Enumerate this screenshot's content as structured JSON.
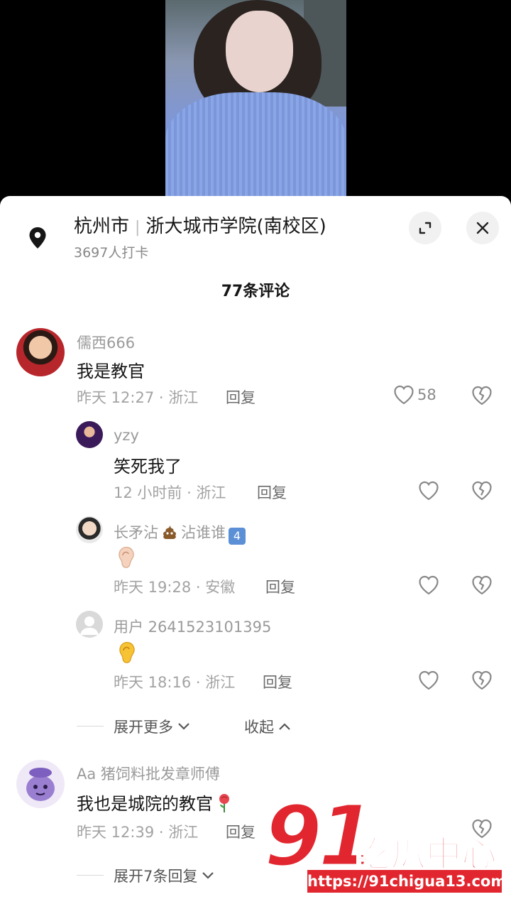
{
  "location": {
    "city": "杭州市",
    "place": "浙大城市学院(南校区)",
    "checkins": "3697人打卡"
  },
  "comments_header": "77条评论",
  "comments": [
    {
      "user": "儒西666",
      "text": "我是教官",
      "meta": "昨天 12:27 · 浙江",
      "reply": "回复",
      "likes": "58"
    },
    {
      "user": "yzy",
      "text": "笑死我了",
      "meta": "12 小时前 · 浙江",
      "reply": "回复"
    },
    {
      "user_a": "长矛沾",
      "user_b": "沾谁谁",
      "badge": "4",
      "meta": "昨天 19:28 · 安徽",
      "reply": "回复"
    },
    {
      "user": "用户 2641523101395",
      "meta": "昨天 18:16 · 浙江",
      "reply": "回复"
    },
    {
      "user": "Aa 猪饲料批发章师傅",
      "text": "我也是城院的教官",
      "meta": "昨天 12:39 · 浙江",
      "reply": "回复"
    }
  ],
  "expand_more": "展开更多",
  "collapse": "收起",
  "expand_replies": "展开7条回复",
  "watermark": {
    "number": "91",
    "name": "吃瓜中心",
    "url": "https://91chigua13.com"
  },
  "icons": [
    "location-pin-icon",
    "expand-icon",
    "close-icon",
    "heart-icon",
    "broken-heart-icon",
    "chevron-down-icon",
    "chevron-up-icon",
    "ear-icon",
    "poop-emoji-icon",
    "rose-emoji-icon"
  ]
}
